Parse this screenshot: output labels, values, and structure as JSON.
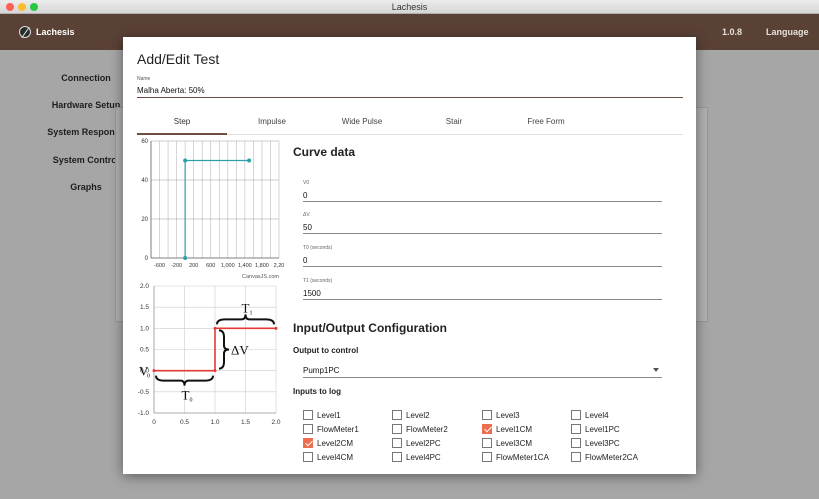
{
  "window": {
    "title": "Lachesis"
  },
  "appbar": {
    "brand": "Lachesis",
    "version": "1.0.8",
    "language": "Language"
  },
  "sidebar": {
    "items": [
      {
        "label": "Connection"
      },
      {
        "label": "Hardware Setup"
      },
      {
        "label": "System Response"
      },
      {
        "label": "System Control"
      },
      {
        "label": "Graphs"
      }
    ]
  },
  "modal": {
    "title": "Add/Edit Test",
    "name_label": "Name",
    "name_value": "Malha Aberta: 50%",
    "tabs": [
      {
        "label": "Step",
        "active": true
      },
      {
        "label": "Impulse"
      },
      {
        "label": "Wide Pulse"
      },
      {
        "label": "Stair"
      },
      {
        "label": "Free Form"
      }
    ],
    "curve_data": {
      "title": "Curve data",
      "fields": [
        {
          "label": "V0",
          "value": "0"
        },
        {
          "label": "ΔV",
          "value": "50"
        },
        {
          "label": "T0 (seconds)",
          "value": "0"
        },
        {
          "label": "T1 (seconds)",
          "value": "1500"
        }
      ]
    },
    "io": {
      "title": "Input/Output Configuration",
      "output_label": "Output to control",
      "output_value": "Pump1PC",
      "inputs_label": "Inputs to log",
      "inputs": [
        {
          "label": "Level1",
          "checked": false
        },
        {
          "label": "Level2",
          "checked": false
        },
        {
          "label": "Level3",
          "checked": false
        },
        {
          "label": "Level4",
          "checked": false
        },
        {
          "label": "FlowMeter1",
          "checked": false
        },
        {
          "label": "FlowMeter2",
          "checked": false
        },
        {
          "label": "Level1CM",
          "checked": true
        },
        {
          "label": "Level1PC",
          "checked": false
        },
        {
          "label": "Level2CM",
          "checked": true
        },
        {
          "label": "Level2PC",
          "checked": false
        },
        {
          "label": "Level3CM",
          "checked": false
        },
        {
          "label": "Level3PC",
          "checked": false
        },
        {
          "label": "Level4CM",
          "checked": false
        },
        {
          "label": "Level4PC",
          "checked": false
        },
        {
          "label": "FlowMeter1CA",
          "checked": false
        },
        {
          "label": "FlowMeter2CA",
          "checked": false
        }
      ]
    }
  },
  "chart_data": [
    {
      "type": "line",
      "x": [
        0,
        0,
        1500
      ],
      "y": [
        0,
        50,
        50
      ],
      "xlim": [
        -800,
        2200
      ],
      "ylim": [
        0,
        60
      ],
      "xticks": [
        -600,
        -200,
        200,
        600,
        1000,
        1400,
        1800,
        2200
      ],
      "xtick_labels": [
        "-600",
        "-200",
        "200",
        "600",
        "1,000",
        "1,400",
        "1,800",
        "2,20"
      ],
      "yticks": [
        0,
        20,
        40,
        60
      ],
      "credit": "CanvasJS.com",
      "grid": true,
      "color": "#2d9fa8"
    },
    {
      "type": "line",
      "x": [
        0,
        1,
        1,
        2
      ],
      "y": [
        0,
        0,
        1,
        1
      ],
      "xlim": [
        0,
        2
      ],
      "ylim": [
        -1,
        2
      ],
      "xticks": [
        0,
        0.5,
        1,
        1.5,
        2
      ],
      "xtick_labels": [
        "0",
        "0.5",
        "1.0",
        "1.5",
        "2.0"
      ],
      "yticks": [
        -1,
        -0.5,
        0,
        0.5,
        1,
        1.5,
        2
      ],
      "ytick_labels": [
        "-1.0",
        "-0.5",
        "0.0",
        "0.5",
        "1.0",
        "1.5",
        "2.0"
      ],
      "annotations": {
        "v0": "V",
        "v0_sub": "0",
        "t0": "T",
        "t0_sub": "0",
        "t1": "T",
        "t1_sub": "1",
        "dv": "ΔV"
      },
      "grid": true,
      "color": "#e53935"
    }
  ]
}
